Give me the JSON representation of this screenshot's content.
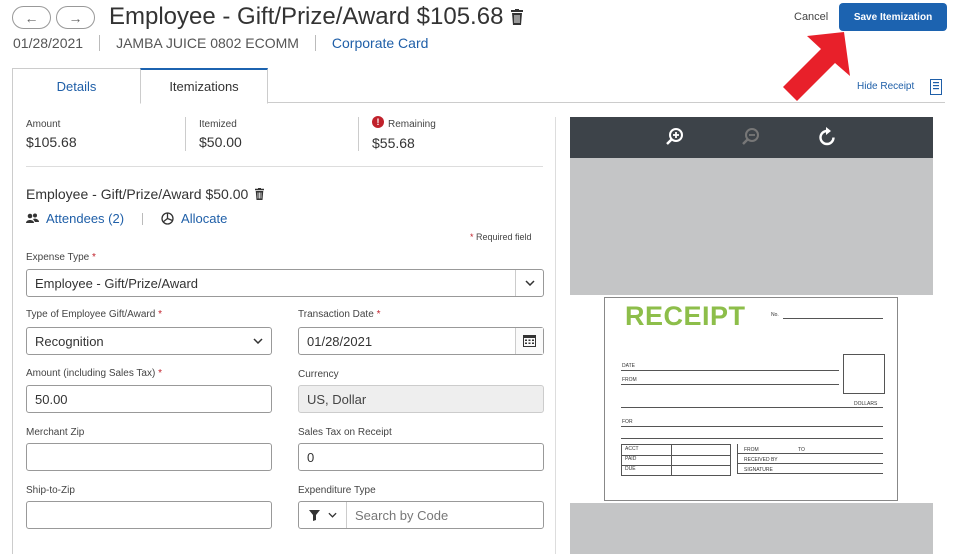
{
  "header": {
    "back_glyph": "←",
    "forward_glyph": "→",
    "title": "Employee - Gift/Prize/Award $105.68",
    "date": "01/28/2021",
    "merchant": "JAMBA JUICE 0802 ECOMM",
    "payment": "Corporate Card",
    "cancel_label": "Cancel",
    "save_label": "Save Itemization",
    "hide_receipt_label": "Hide Receipt"
  },
  "tabs": [
    {
      "label": "Details",
      "active": false
    },
    {
      "label": "Itemizations",
      "active": true
    }
  ],
  "summary": {
    "amount_label": "Amount",
    "amount_value": "$105.68",
    "itemized_label": "Itemized",
    "itemized_value": "$50.00",
    "remaining_label": "Remaining",
    "remaining_value": "$55.68",
    "remaining_alert_glyph": "!"
  },
  "itemization": {
    "title": "Employee - Gift/Prize/Award $50.00",
    "attendees_label": "Attendees (2)",
    "allocate_label": "Allocate",
    "required_note": "Required field",
    "required_star": "*"
  },
  "form": {
    "expense_type_label": "Expense Type",
    "expense_type_value": "Employee - Gift/Prize/Award",
    "gift_type_label": "Type of Employee Gift/Award",
    "gift_type_value": "Recognition",
    "transaction_date_label": "Transaction Date",
    "transaction_date_value": "01/28/2021",
    "amount_label": "Amount (including Sales Tax)",
    "amount_value": "50.00",
    "currency_label": "Currency",
    "currency_value": "US, Dollar",
    "merchant_zip_label": "Merchant Zip",
    "merchant_zip_value": "",
    "sales_tax_label": "Sales Tax on Receipt",
    "sales_tax_value": "0",
    "ship_to_zip_label": "Ship-to-Zip",
    "ship_to_zip_value": "",
    "expenditure_type_label": "Expenditure Type",
    "expenditure_type_placeholder": "Search by Code"
  },
  "receipt": {
    "title": "RECEIPT",
    "no_label": "No.",
    "date_label": "DATE",
    "from_label": "FROM",
    "dollars_label": "DOLLARS",
    "for_label": "FOR",
    "acct_label": "ACCT",
    "paid_label": "PAID",
    "due_label": "DUE",
    "from2_label": "FROM",
    "to_label": "TO",
    "received_by_label": "RECEIVED BY",
    "signature_label": "SIGNATURE"
  },
  "colors": {
    "primary": "#1c63b0",
    "link": "#1f5fa8",
    "required": "#c0212b",
    "arrow": "#e8202a",
    "receipt_green": "#8dbe4a"
  }
}
